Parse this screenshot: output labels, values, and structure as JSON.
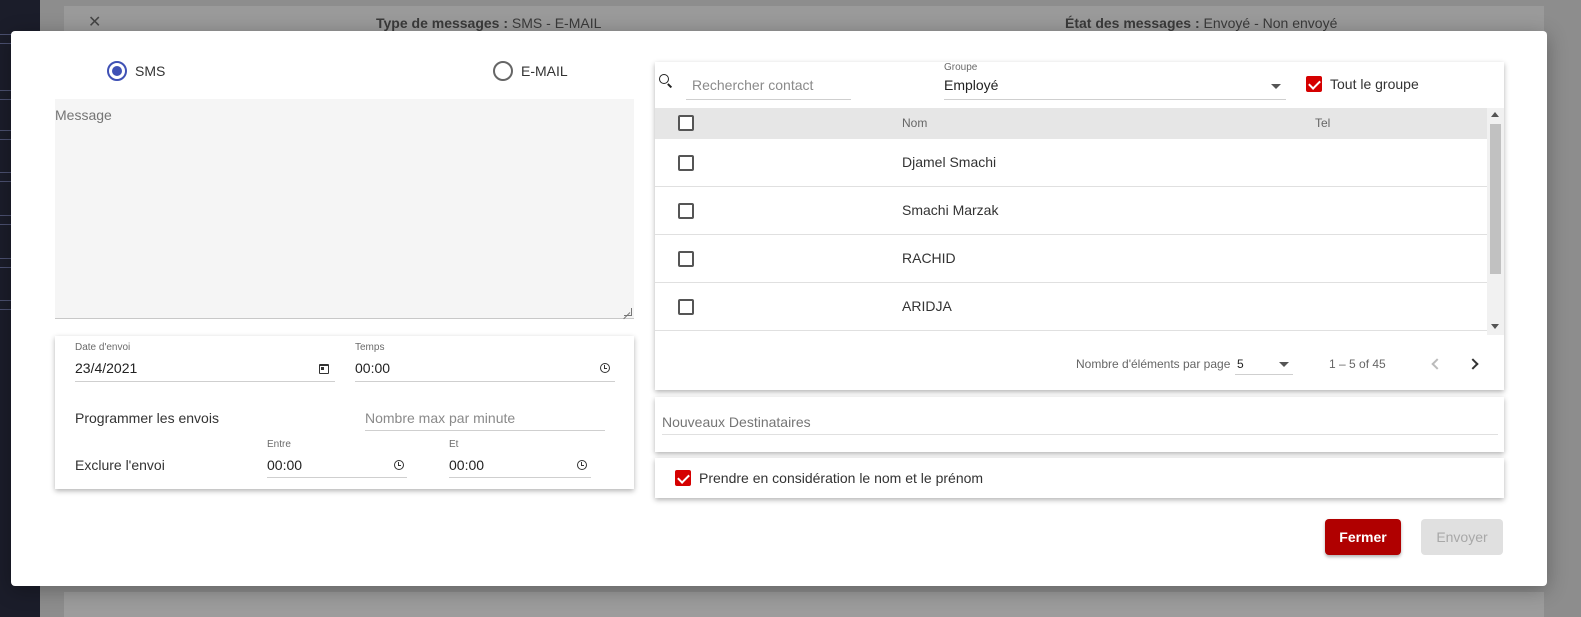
{
  "background": {
    "close_glyph": "✕",
    "type_label": "Type de messages :",
    "type_value": " SMS - E-MAIL",
    "etat_label": "État des messages :",
    "etat_value": " Envoyé - Non envoyé"
  },
  "compose": {
    "radio_sms": "SMS",
    "radio_email": "E-MAIL",
    "selected_channel": "SMS",
    "message_placeholder": "Message"
  },
  "schedule": {
    "date_label": "Date d'envoi",
    "date_value": "23/4/2021",
    "time_label": "Temps",
    "time_value": "00:00",
    "program_label": "Programmer les envois",
    "max_per_minute_placeholder": "Nombre max par minute",
    "exclude_label": "Exclure l'envoi",
    "between_label": "Entre",
    "between_value": "00:00",
    "and_label": "Et",
    "and_value": "00:00"
  },
  "contacts": {
    "search_placeholder": "Rechercher contact",
    "group_label": "Groupe",
    "group_value": "Employé",
    "whole_group_label": "Tout le groupe",
    "whole_group_checked": true,
    "columns": [
      "Nom",
      "Tel"
    ],
    "rows": [
      {
        "name": "Djamel Smachi",
        "tel": ""
      },
      {
        "name": "Smachi Marzak",
        "tel": ""
      },
      {
        "name": "RACHID",
        "tel": ""
      },
      {
        "name": "ARIDJA",
        "tel": ""
      }
    ],
    "page_size_label": "Nombre d'éléments par page",
    "page_size_value": "5",
    "range_label": "1 – 5 of 45"
  },
  "recipients": {
    "placeholder": "Nouveaux Destinataires"
  },
  "consider": {
    "label": "Prendre en considération le nom et le prénom",
    "checked": true
  },
  "actions": {
    "close_label": "Fermer",
    "send_label": "Envoyer"
  },
  "colors": {
    "accent_radio": "#3f51b5",
    "checkbox_red": "#d50000",
    "close_button": "#b00000"
  }
}
